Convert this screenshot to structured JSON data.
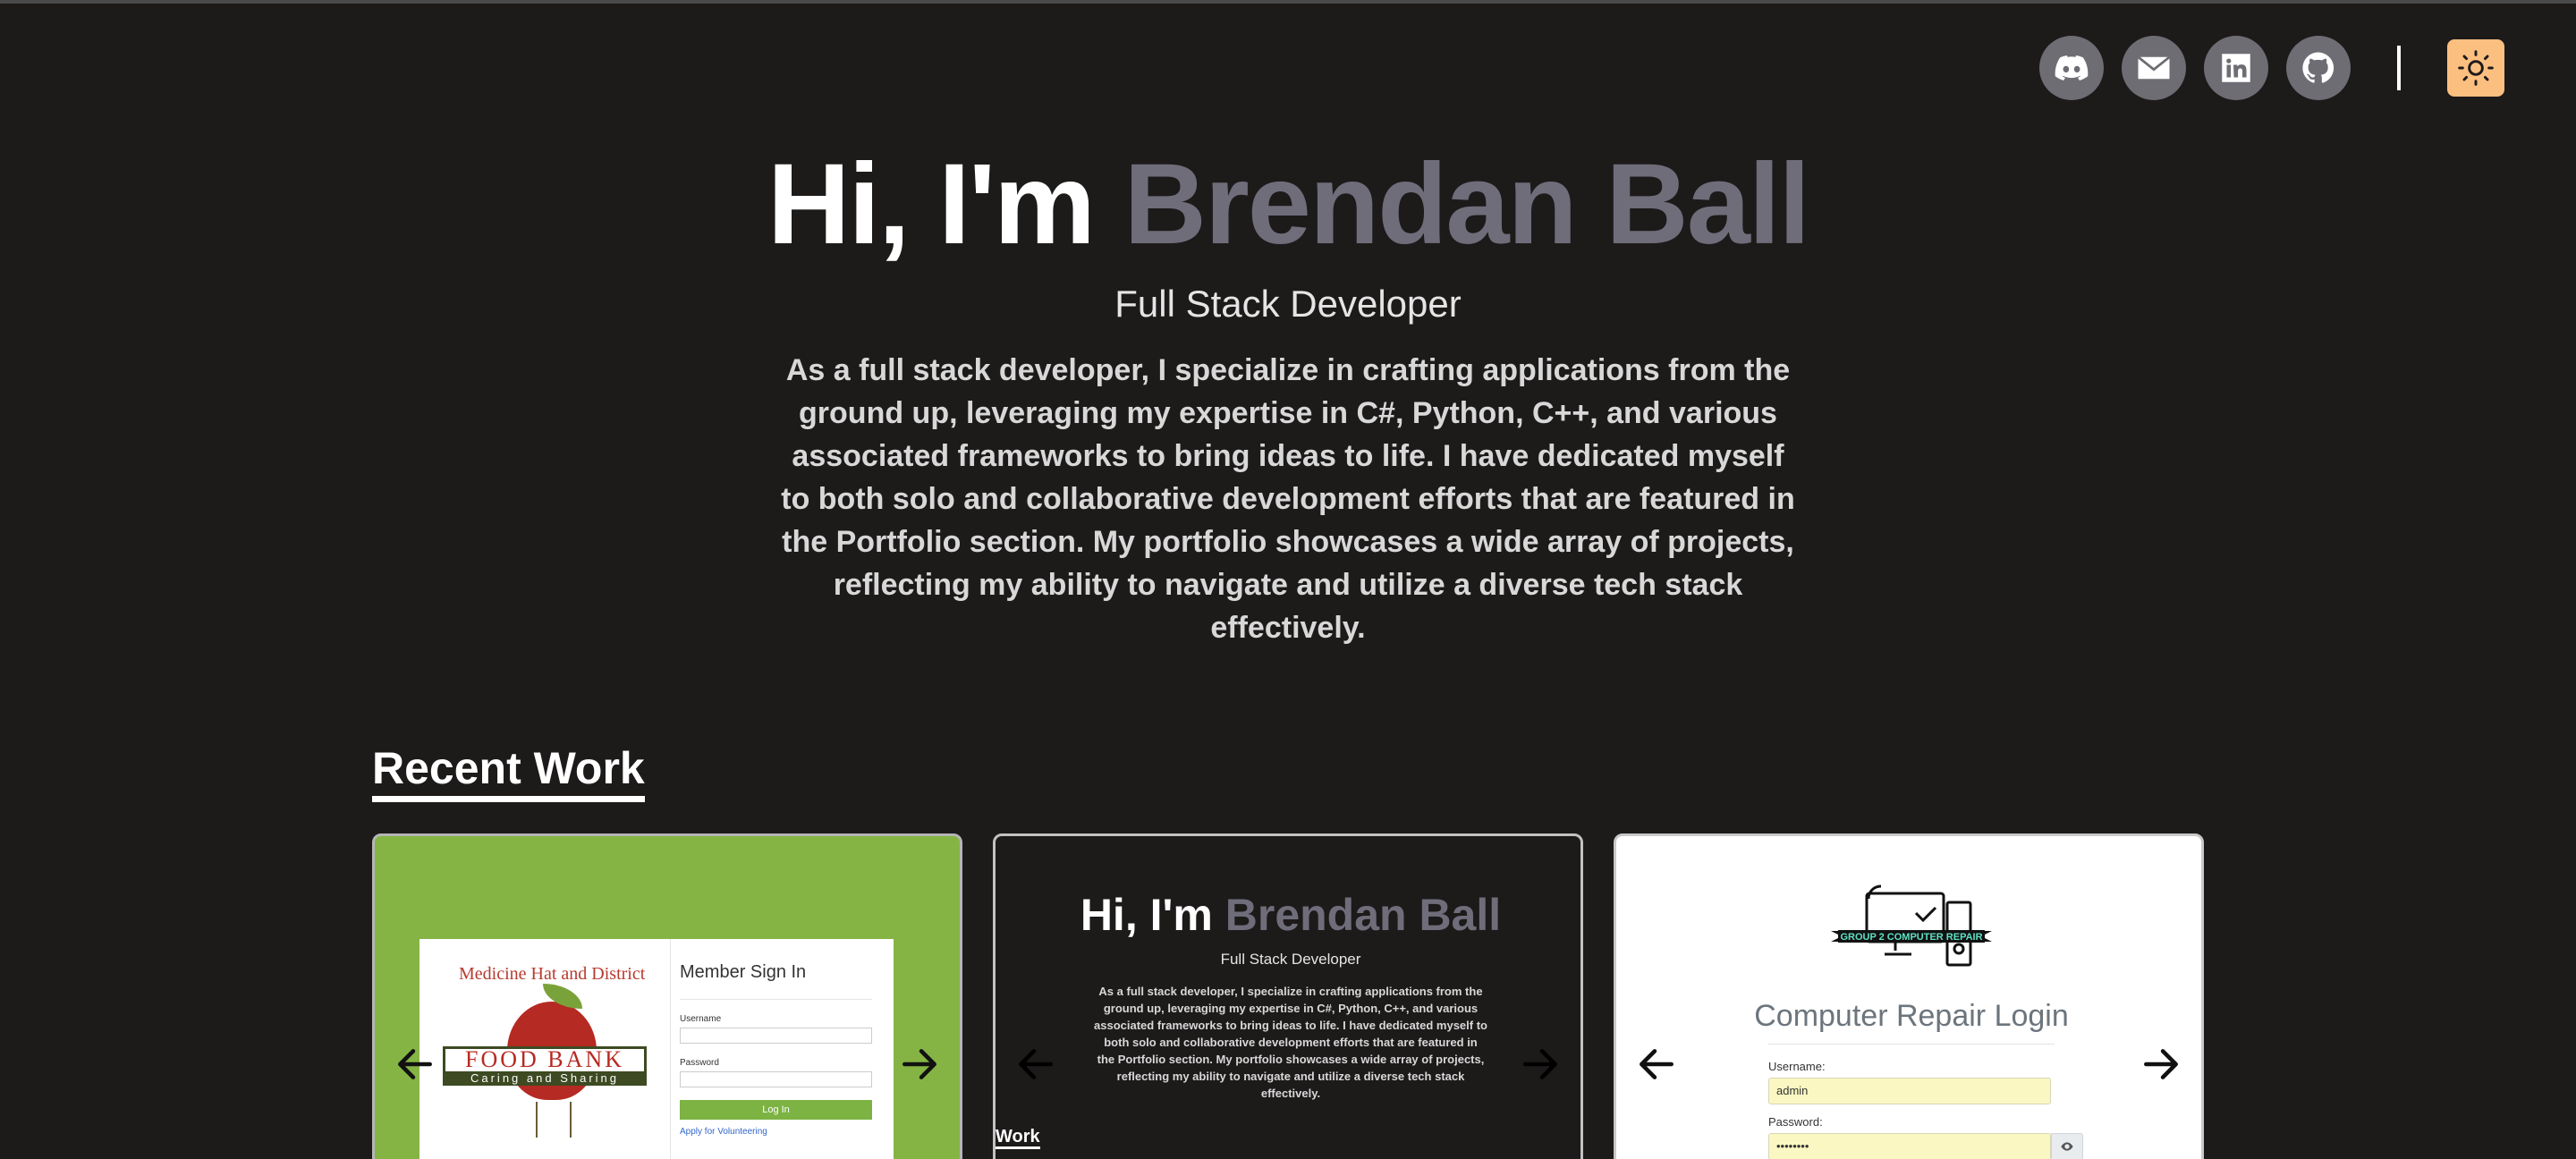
{
  "social": [
    {
      "name": "discord-icon",
      "label": "Discord"
    },
    {
      "name": "mail-icon",
      "label": "Email"
    },
    {
      "name": "linkedin-icon",
      "label": "LinkedIn"
    },
    {
      "name": "github-icon",
      "label": "GitHub"
    }
  ],
  "theme": {
    "icon": "sun-icon",
    "accent": "#fbbf80"
  },
  "hero": {
    "greeting": "Hi, I'm ",
    "name": "Brendan Ball",
    "role": "Full Stack Developer",
    "bio": "As a full stack developer, I specialize in crafting applications from the ground up, leveraging my expertise in C#, Python, C++, and various associated frameworks to bring ideas to life. I have dedicated myself to both solo and collaborative development efforts that are featured in the Portfolio section. My portfolio showcases a wide array of projects, reflecting my ability to navigate and utilize a diverse tech stack effectively."
  },
  "recent_work": {
    "title": "Recent Work",
    "cards": [
      {
        "logo_text_arc": "Medicine Hat and District",
        "logo_main": "FOOD BANK",
        "logo_sub": "Caring and Sharing",
        "form_title": "Member Sign In",
        "username_label": "Username",
        "password_label": "Password",
        "login_button": "Log In",
        "volunteer_link": "Apply for Volunteering"
      },
      {
        "greeting": "Hi, I'm ",
        "name": "Brendan Ball",
        "role": "Full Stack Developer",
        "bio": "As a full stack developer, I specialize in crafting applications from the ground up, leveraging my expertise in C#, Python, C++, and various associated frameworks to bring ideas to life. I have dedicated myself to both solo and collaborative development efforts that are featured in the Portfolio section. My portfolio showcases a wide array of projects, reflecting my ability to navigate and utilize a diverse tech stack effectively.",
        "work_label": "Work"
      },
      {
        "logo_banner": "GROUP 2 COMPUTER REPAIR",
        "title": "Computer Repair Login",
        "username_label": "Username:",
        "username_value": "admin",
        "password_label": "Password:",
        "password_value": "••••••••"
      }
    ]
  },
  "colors": {
    "background": "#1d1a1a",
    "name_accent": "#6f6d7a",
    "social_bg": "#6e6d74"
  }
}
